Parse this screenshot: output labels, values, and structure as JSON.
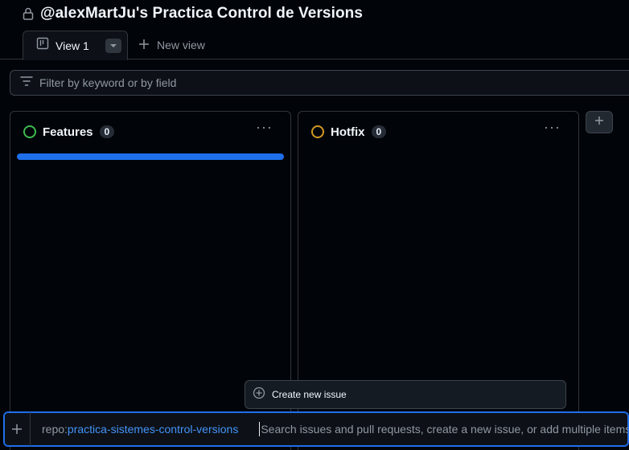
{
  "header": {
    "title": "@alexMartJu's Practica Control de Versions",
    "lock_icon": "lock-icon"
  },
  "tabs": {
    "active_label": "View 1",
    "new_view_label": "New view"
  },
  "filter": {
    "placeholder": "Filter by keyword or by field"
  },
  "columns": [
    {
      "title": "Features",
      "count": "0",
      "status_color": "#3fb950"
    },
    {
      "title": "Hotfix",
      "count": "0",
      "status_color": "#d29922"
    }
  ],
  "colors": {
    "background": "#010409",
    "accent": "#1f6feb",
    "link": "#4493f8"
  },
  "popup": {
    "create_label": "Create new issue"
  },
  "omnibar": {
    "repo_prefix": "repo:",
    "repo_name": "practica-sistemes-control-versions",
    "placeholder": "Search issues and pull requests, create a new issue, or add multiple items"
  }
}
